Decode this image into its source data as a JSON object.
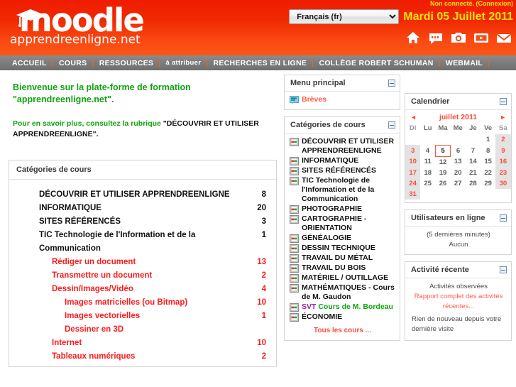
{
  "header": {
    "logo_main": "moodle",
    "logo_sub": "apprendreenligne.net",
    "login_status": "Non connecté.",
    "login_link": "(Connexion)",
    "language_selected": "Français (fr)",
    "date": "Mardi 05 Juillet 2011",
    "icons": [
      "home-icon",
      "chat-icon",
      "camera-icon",
      "video-icon",
      "mail-icon"
    ],
    "colors": {
      "red": "#ef1c00",
      "orange": "#fb5516",
      "yellow": "#ffe400"
    }
  },
  "nav": {
    "items": [
      "ACCUEIL",
      "COURS",
      "RESSOURCES",
      "à attribuer",
      "RECHERCHES EN LIGNE",
      "COLLÈGE ROBERT SCHUMAN",
      "WEBMAIL"
    ]
  },
  "welcome": {
    "title_line1": "Bienvenue sur la plate-forme de formation",
    "title_line2": "\"apprendreenligne.net\".",
    "sub_green": "Pour en savoir plus, consultez la rubrique ",
    "sub_black": "\"DÉCOUVRIR ET UTILISER APPRENDREENLIGNE\"."
  },
  "course_categories_panel": {
    "heading": "Catégories de cours",
    "rows": [
      {
        "name": "DÉCOUVRIR ET UTILISER APPRENDREENLIGNE",
        "count": "8",
        "level": 0
      },
      {
        "name": "INFORMATIQUE",
        "count": "20",
        "level": 0
      },
      {
        "name": "SITES RÉFÉRENCÉS",
        "count": "3",
        "level": 0
      },
      {
        "name": "TIC Technologie de l'Information et de la Communication",
        "count": "1",
        "level": 0
      },
      {
        "name": "Rédiger un document",
        "count": "13",
        "level": 1
      },
      {
        "name": "Transmettre un document",
        "count": "2",
        "level": 1
      },
      {
        "name": "Dessin/Images/Vidéo",
        "count": "4",
        "level": 1
      },
      {
        "name": "Images matricielles (ou Bitmap)",
        "count": "10",
        "level": 2
      },
      {
        "name": "Images vectorielles",
        "count": "1",
        "level": 2
      },
      {
        "name": "Dessiner en 3D",
        "count": "",
        "level": 2
      },
      {
        "name": "Internet",
        "count": "10",
        "level": 1
      },
      {
        "name": "Tableaux numériques",
        "count": "2",
        "level": 1
      }
    ]
  },
  "menu_principal": {
    "title": "Menu principal",
    "items": [
      {
        "label": "Brèves",
        "icon": "news-icon"
      }
    ]
  },
  "categories_block": {
    "title": "Catégories de cours",
    "items": [
      {
        "label": "DÉCOUVRIR ET UTILISER APPRENDREENLIGNE"
      },
      {
        "label": "INFORMATIQUE"
      },
      {
        "label": "SITES RÉFÉRENCÉS"
      },
      {
        "label": "TIC Technologie de l'Information et de la Communication"
      },
      {
        "label": "PHOTOGRAPHIE"
      },
      {
        "label": "CARTOGRAPHIE - ORIENTATION"
      },
      {
        "label": "GÉNÉALOGIE"
      },
      {
        "label": "DESSIN TECHNIQUE"
      },
      {
        "label": "TRAVAIL DU MÉTAL"
      },
      {
        "label": "TRAVAIL DU BOIS"
      },
      {
        "label": "MATÉRIEL / OUTILLAGE"
      },
      {
        "label": "MATHÉMATIQUES - Cours de M. Gaudon"
      },
      {
        "label": "SVT Cours de M. Bordeau",
        "highlight": "SVT",
        "rest": " Cours de M. Bordeau"
      },
      {
        "label": "ÉCONOMIE"
      }
    ],
    "all_courses": "Tous les cours",
    "all_courses_dots": "..."
  },
  "calendar": {
    "title": "Calendrier",
    "prev": "◄",
    "next": "►",
    "month": "juillet 2011",
    "weekdays": [
      "Di",
      "Lu",
      "Ma",
      "Me",
      "Je",
      "Ve",
      "Sa"
    ],
    "weeks": [
      [
        "",
        "",
        "",
        "",
        "",
        "1",
        "2"
      ],
      [
        "3",
        "4",
        "5",
        "6",
        "7",
        "8",
        "9"
      ],
      [
        "10",
        "11",
        "12",
        "13",
        "14",
        "15",
        "16"
      ],
      [
        "17",
        "18",
        "19",
        "20",
        "21",
        "22",
        "23"
      ],
      [
        "24",
        "25",
        "26",
        "27",
        "28",
        "29",
        "30"
      ],
      [
        "31",
        "",
        "",
        "",
        "",
        "",
        ""
      ]
    ],
    "today": "5",
    "weekend_columns": [
      0,
      6
    ]
  },
  "online_users": {
    "title": "Utilisateurs en ligne",
    "subtitle": "(5 dernières minutes)",
    "value": "Aucun"
  },
  "recent_activity": {
    "title": "Activité récente",
    "subtitle": "Activités observées",
    "report_link": "Rapport complet des activités récentes...",
    "status": "Rien de nouveau depuis votre dernière visite"
  }
}
